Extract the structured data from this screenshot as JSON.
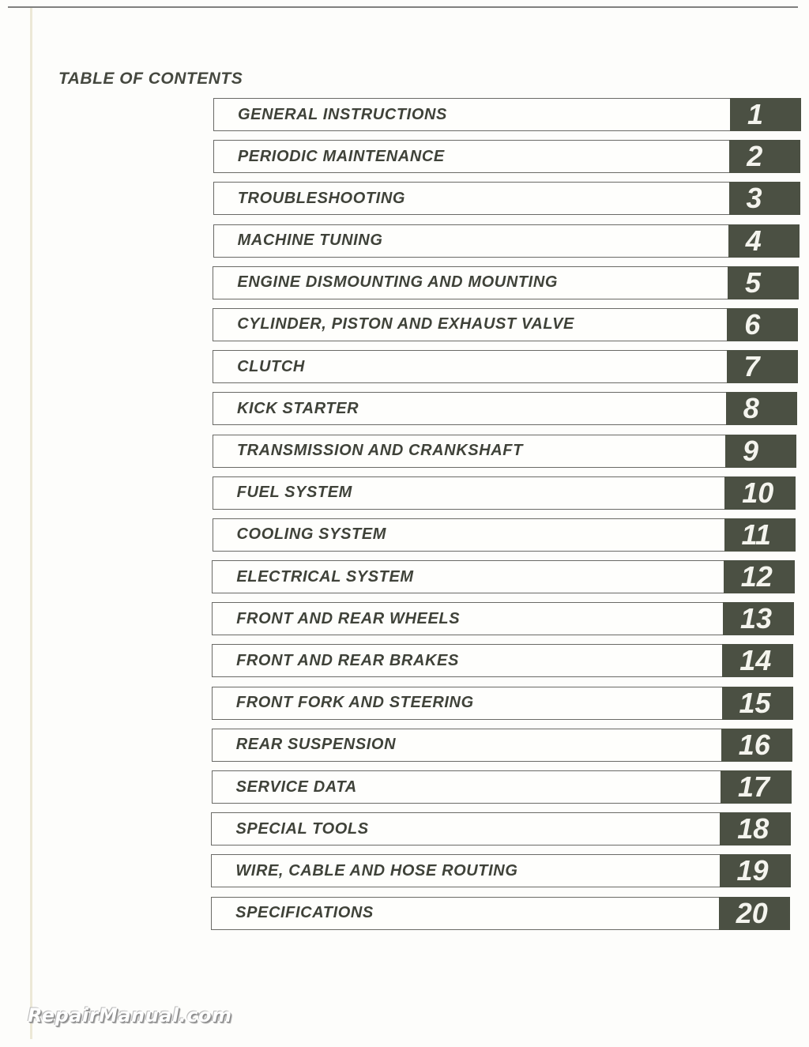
{
  "page": {
    "title": "TABLE OF CONTENTS",
    "watermark": "RepairManual.com",
    "colors": {
      "tab_fill": "#4b5043",
      "text": "#3f4239",
      "page": "#fdfdfb"
    }
  },
  "toc": [
    {
      "label": "GENERAL INSTRUCTIONS",
      "number": "1"
    },
    {
      "label": "PERIODIC MAINTENANCE",
      "number": "2"
    },
    {
      "label": "TROUBLESHOOTING",
      "number": "3"
    },
    {
      "label": "MACHINE TUNING",
      "number": "4"
    },
    {
      "label": "ENGINE DISMOUNTING AND MOUNTING",
      "number": "5"
    },
    {
      "label": "CYLINDER, PISTON AND EXHAUST VALVE",
      "number": "6"
    },
    {
      "label": "CLUTCH",
      "number": "7"
    },
    {
      "label": "KICK STARTER",
      "number": "8"
    },
    {
      "label": "TRANSMISSION AND CRANKSHAFT",
      "number": "9"
    },
    {
      "label": "FUEL SYSTEM",
      "number": "10"
    },
    {
      "label": "COOLING SYSTEM",
      "number": "11"
    },
    {
      "label": "ELECTRICAL SYSTEM",
      "number": "12"
    },
    {
      "label": "FRONT AND REAR WHEELS",
      "number": "13"
    },
    {
      "label": "FRONT AND REAR BRAKES",
      "number": "14"
    },
    {
      "label": "FRONT FORK AND STEERING",
      "number": "15"
    },
    {
      "label": "REAR SUSPENSION",
      "number": "16"
    },
    {
      "label": "SERVICE DATA",
      "number": "17"
    },
    {
      "label": "SPECIAL TOOLS",
      "number": "18"
    },
    {
      "label": "WIRE, CABLE AND HOSE ROUTING",
      "number": "19"
    },
    {
      "label": "SPECIFICATIONS",
      "number": "20"
    }
  ]
}
